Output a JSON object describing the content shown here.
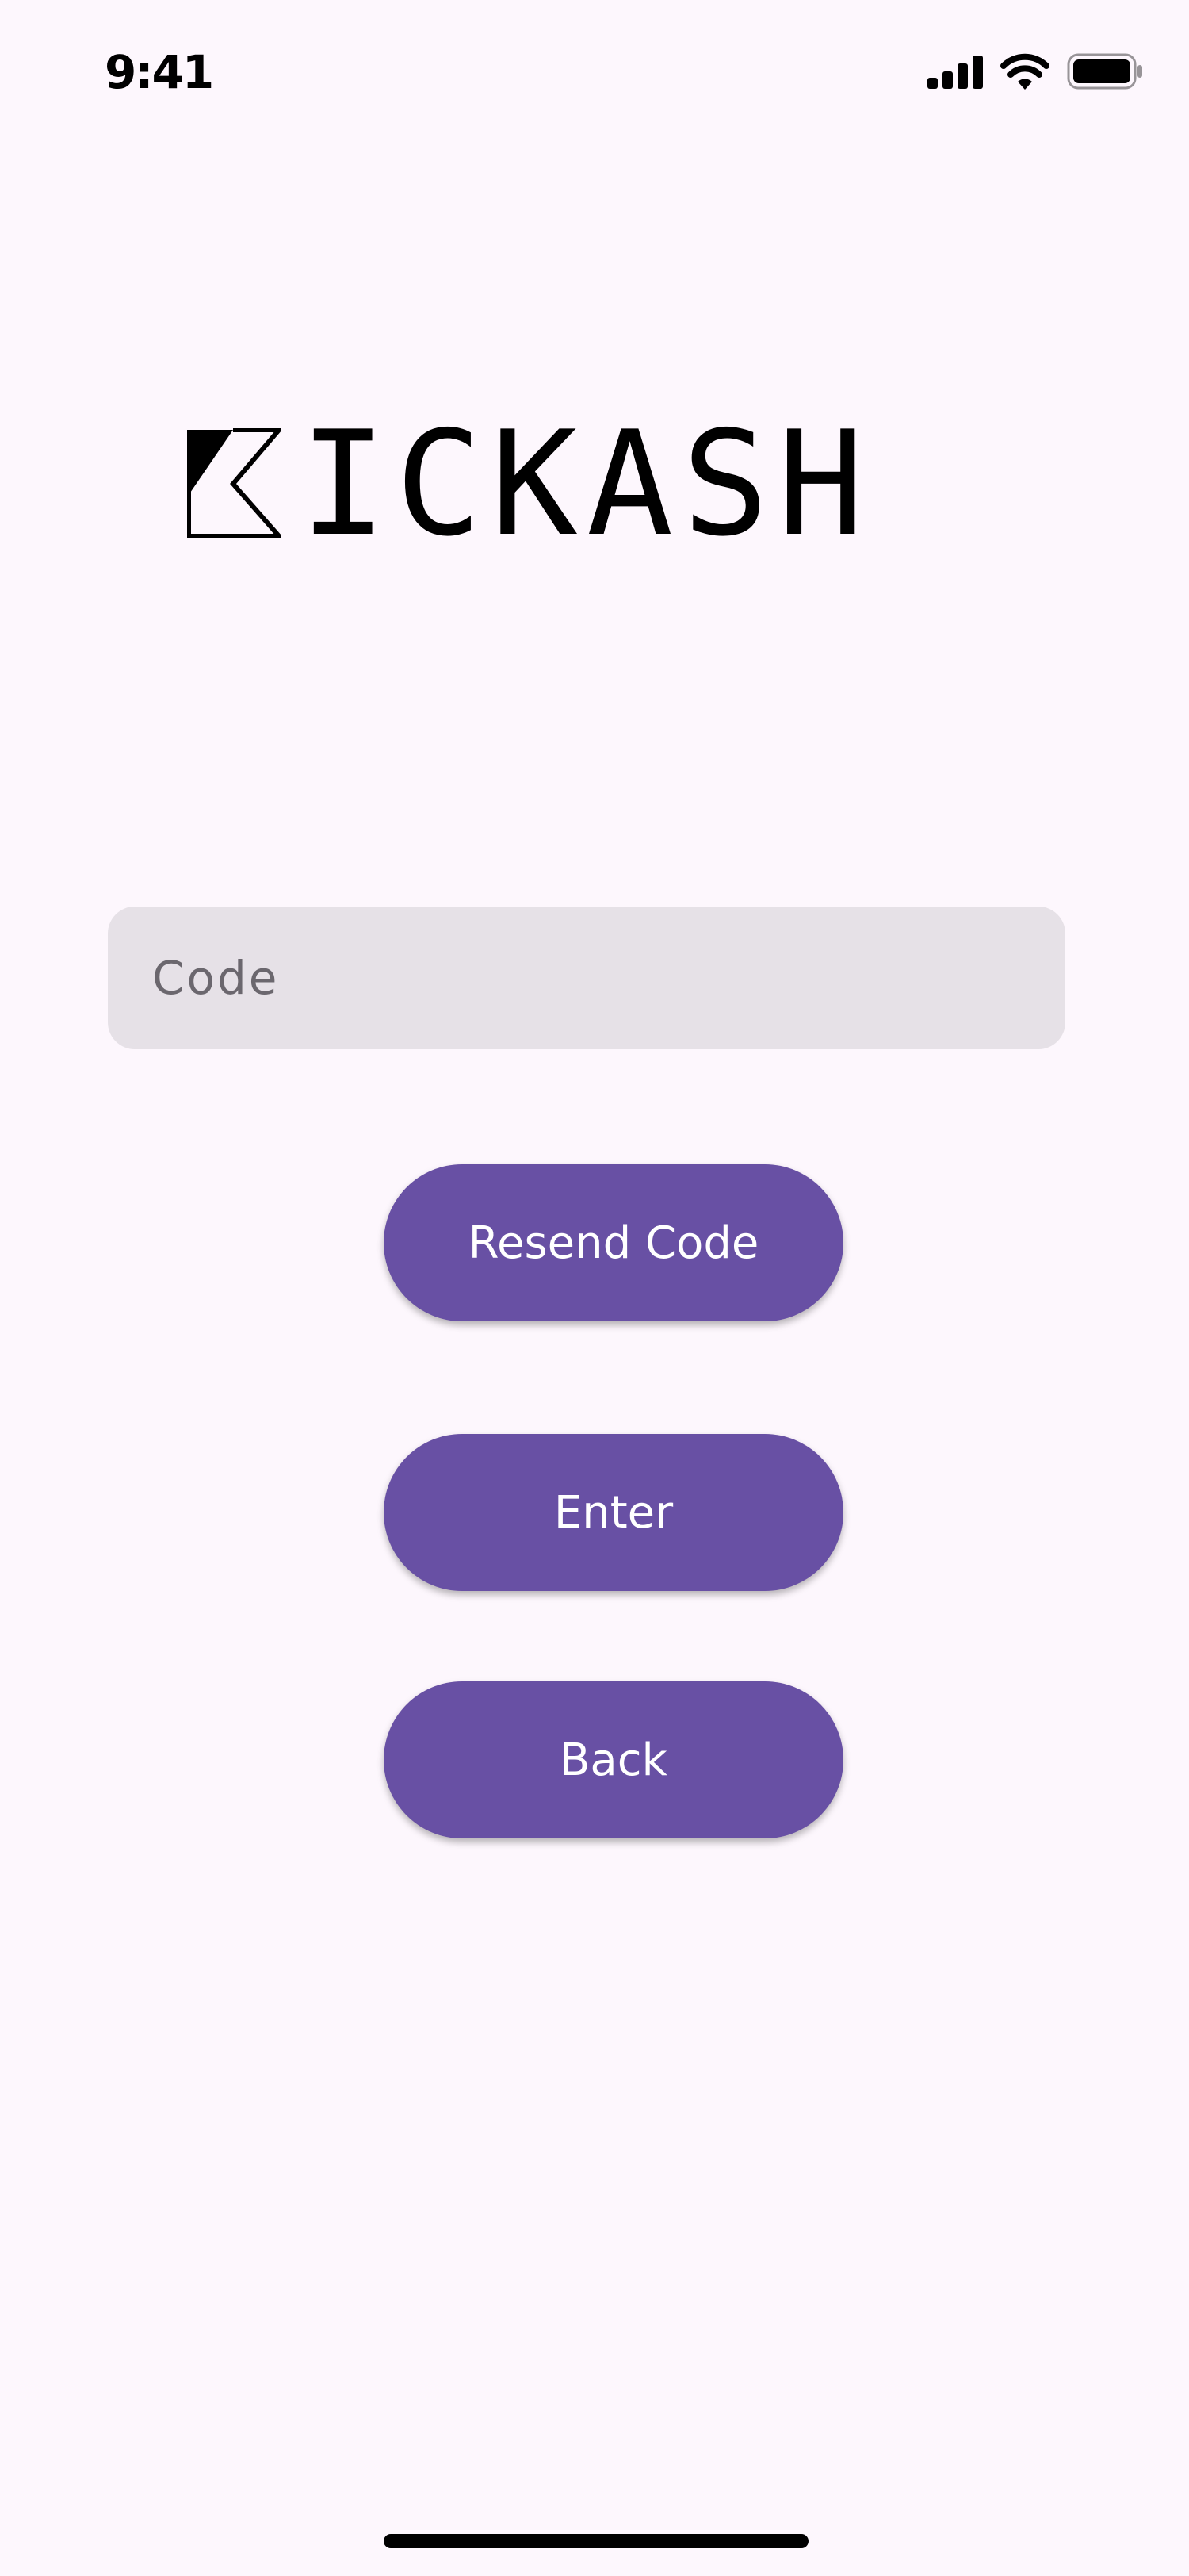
{
  "status_bar": {
    "time": "9:41",
    "signal_icon": "cellular-signal-icon",
    "wifi_icon": "wifi-icon",
    "battery_icon": "battery-icon"
  },
  "logo": {
    "text": "KICKASH",
    "visible_letters": "ICKASH",
    "mark_icon": "kickash-k-mark-icon"
  },
  "code_input": {
    "value": "",
    "placeholder": "Code"
  },
  "buttons": {
    "resend_label": "Resend Code",
    "enter_label": "Enter",
    "back_label": "Back"
  },
  "colors": {
    "background": "#fdf7fd",
    "button": "#6850a4",
    "button_text": "#ffffff",
    "input_background": "#e6e1e7",
    "placeholder": "#6b676e"
  }
}
